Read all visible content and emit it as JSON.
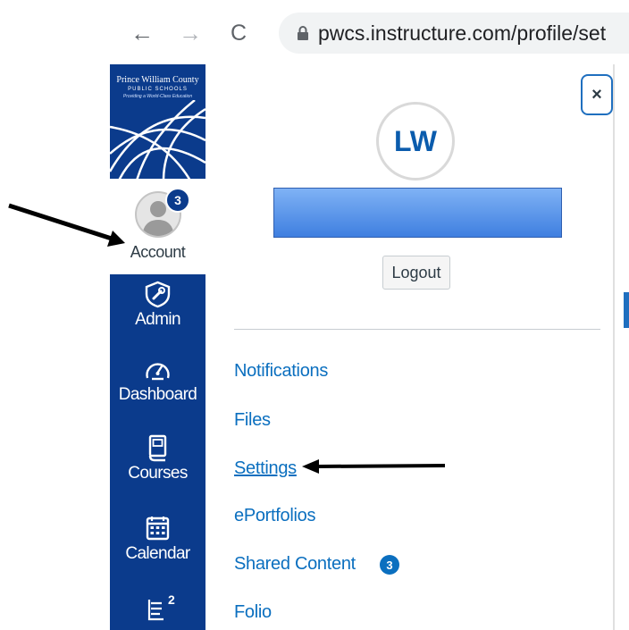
{
  "browser": {
    "url": "pwcs.instructure.com/profile/set",
    "back_glyph": "←",
    "forward_glyph": "→",
    "reload_glyph": "C"
  },
  "logo": {
    "line1": "Prince William County",
    "line2": "PUBLIC SCHOOLS",
    "line3": "Providing a World-Class Education"
  },
  "global_nav": {
    "account": {
      "label": "Account",
      "badge": "3"
    },
    "items": [
      {
        "label": "Admin",
        "icon": "shield-wrench-icon"
      },
      {
        "label": "Dashboard",
        "icon": "speedometer-icon"
      },
      {
        "label": "Courses",
        "icon": "book-icon"
      },
      {
        "label": "Calendar",
        "icon": "calendar-icon"
      },
      {
        "label": "",
        "icon": "inbox-icon",
        "badge": "2"
      }
    ]
  },
  "tray": {
    "close_glyph": "×",
    "initials": "LW",
    "logout_label": "Logout",
    "links": [
      {
        "label": "Notifications"
      },
      {
        "label": "Files"
      },
      {
        "label": "Settings",
        "underlined": true
      },
      {
        "label": "ePortfolios"
      },
      {
        "label": "Shared Content",
        "badge": "3"
      },
      {
        "label": "Folio"
      }
    ]
  },
  "colors": {
    "nav_blue": "#0b3b8c",
    "link_blue": "#0b6fbf",
    "redaction_blue": "#5b95ea"
  }
}
